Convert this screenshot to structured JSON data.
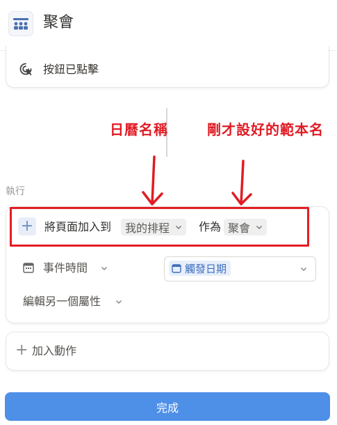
{
  "header": {
    "title": "聚會",
    "icon": "group-people-icon"
  },
  "trigger": {
    "label": "按鈕已點擊",
    "icon": "click-pointer-icon"
  },
  "annotations": {
    "calendar_name": "日曆名稱",
    "template_name": "剛才設好的範本名",
    "color": "#e01b24"
  },
  "section": {
    "label": "執行"
  },
  "action": {
    "prefix": "將頁面加入到",
    "calendar": "我的排程",
    "as_text": "作為",
    "template": "聚會",
    "event_time_label": "事件時間",
    "event_time_value": "觸發日期",
    "edit_property": "編輯另一個屬性"
  },
  "add_action": {
    "label": "加入動作"
  },
  "done_button": {
    "label": "完成",
    "color": "#4e8fe8"
  }
}
